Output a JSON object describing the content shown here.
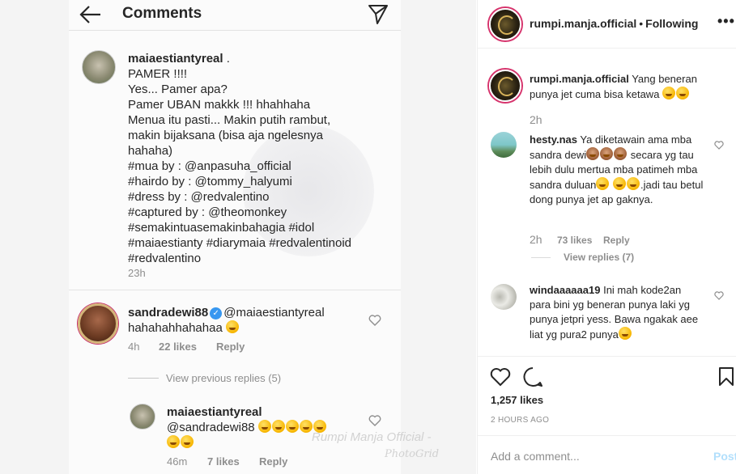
{
  "screenshot": {
    "header_title": "Comments",
    "comments": [
      {
        "username": "maiaestiantyreal",
        "suffix": ".",
        "lines": [
          "PAMER !!!!",
          "Yes... Pamer apa?",
          "Pamer UBAN makkk !!! hhahhaha",
          "Menua itu pasti... Makin putih rambut,",
          "makin bijaksana (bisa aja ngelesnya",
          "hahaha)",
          "#mua by : @anpasuha_official",
          "#hairdo by : @tommy_halyumi",
          "#dress by : @redvalentino",
          "#captured by : @theomonkey",
          "#semakintuasemakinbahagia #idol",
          "#maiaestianty #diarymaia #redvalentinoid",
          "#redvalentino"
        ],
        "time": "23h"
      },
      {
        "username": "sandradewi88",
        "mention": "@maiaestiantyreal",
        "text": "hahahahhahahaa",
        "time": "4h",
        "likes": "22 likes",
        "reply": "Reply"
      }
    ],
    "view_previous": "View previous replies (5)",
    "reply": {
      "username": "maiaestiantyreal",
      "mention": "@sandradewi88",
      "time": "46m",
      "likes": "7 likes",
      "reply": "Reply"
    },
    "watermark": "Rumpi Manja Official -",
    "watermark_sig": "PhotoGrid"
  },
  "post": {
    "account": "rumpi.manja.official",
    "follow_state": "Following",
    "more": "•••",
    "caption_user": "rumpi.manja.official",
    "caption_text": "Yang beneran punya jet cuma bisa ketawa",
    "caption_time": "2h",
    "comments": [
      {
        "username": "hesty.nas",
        "text_a": "Ya diketawain ama mba sandra dewi",
        "text_b": "secara yg tau lebih dulu mertua mba patimeh mba sandra duluan",
        "text_c": ".jadi tau betul dong punya jet ap gaknya.",
        "time": "2h",
        "likes": "73 likes",
        "reply": "Reply",
        "view_replies": "View replies (7)"
      },
      {
        "username": "windaaaaaa19",
        "text": "Ini mah kode2an para bini yg beneran punya laki yg punya jetpri yess. Bawa ngakak aee liat yg pura2 punya"
      }
    ],
    "likes": "1,257 likes",
    "timestamp": "2 HOURS AGO",
    "add_comment_placeholder": "Add a comment...",
    "post_label": "Post",
    "colors": {
      "story_ring": "#d6336c",
      "link_blue": "#3897f0",
      "post_disabled": "#b2dffc"
    }
  }
}
